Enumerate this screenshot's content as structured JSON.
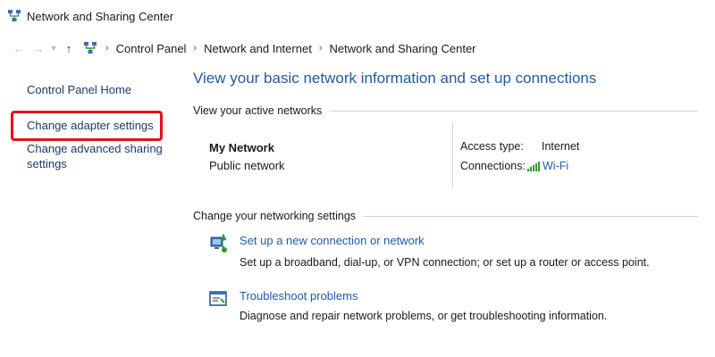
{
  "window": {
    "title": "Network and Sharing Center"
  },
  "address": {
    "breadcrumbs": [
      "Control Panel",
      "Network and Internet",
      "Network and Sharing Center"
    ]
  },
  "sidebar": {
    "items": [
      {
        "label": "Control Panel Home"
      },
      {
        "label": "Change adapter settings"
      },
      {
        "label": "Change advanced sharing settings"
      }
    ],
    "highlight_color": "#e0121b"
  },
  "main": {
    "title": "View your basic network information and set up connections",
    "active_networks_header": "View your active networks",
    "network": {
      "name": "My Network",
      "type": "Public network",
      "access_type_label": "Access type:",
      "access_type_value": "Internet",
      "connections_label": "Connections:",
      "connections_value": "Wi-Fi"
    },
    "settings_header": "Change your networking settings",
    "tasks": [
      {
        "link": "Set up a new connection or network",
        "description": "Set up a broadband, dial-up, or VPN connection; or set up a router or access point.",
        "icon": "network-setup-icon"
      },
      {
        "link": "Troubleshoot problems",
        "description": "Diagnose and repair network problems, or get troubleshooting information.",
        "icon": "troubleshoot-icon"
      }
    ]
  },
  "colors": {
    "link_blue": "#1f5aa6",
    "sidebar_link": "#1a3a6b",
    "wifi_green": "#2e9b2e"
  }
}
